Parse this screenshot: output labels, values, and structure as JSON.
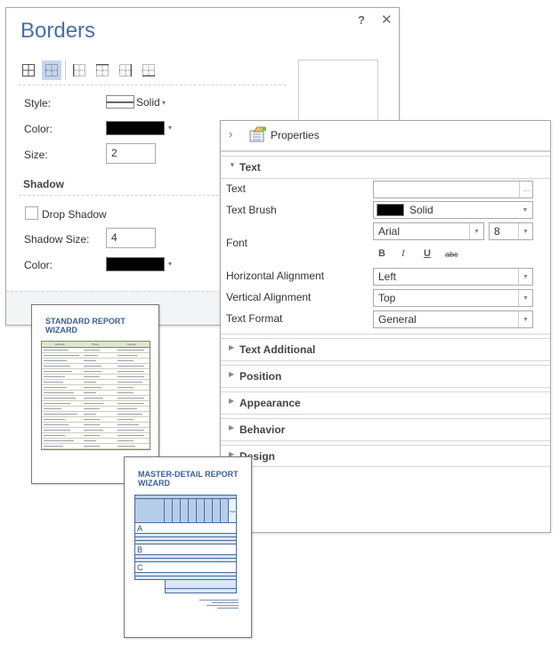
{
  "borders_dialog": {
    "title": "Borders",
    "help_label": "?",
    "close_label": "✕",
    "presets": [
      {
        "name": "all-borders",
        "selected": false
      },
      {
        "name": "no-borders",
        "selected": true
      },
      {
        "name": "left-border",
        "selected": false
      },
      {
        "name": "top-border",
        "selected": false
      },
      {
        "name": "right-border",
        "selected": false
      },
      {
        "name": "bottom-border",
        "selected": false
      }
    ],
    "style_label": "Style:",
    "style_value": "Solid",
    "color_label": "Color:",
    "color_value": "#000000",
    "size_label": "Size:",
    "size_value": "2",
    "shadow_title": "Shadow",
    "drop_shadow_label": "Drop Shadow",
    "drop_shadow_checked": false,
    "shadow_size_label": "Shadow Size:",
    "shadow_size_value": "4",
    "shadow_color_label": "Color:",
    "shadow_color_value": "#000000",
    "dropdown_glyph": "▾"
  },
  "reports": {
    "standard": {
      "title_line1": "STANDARD REPORT",
      "title_line2": "WIZARD",
      "columns": [
        "Address",
        "Phone",
        "Contact"
      ]
    },
    "master_detail": {
      "title_line1": "MASTER-DETAIL REPORT",
      "title_line2": "WIZARD",
      "groups": [
        "A",
        "B",
        "C"
      ],
      "total_label": "Total"
    }
  },
  "properties_panel": {
    "expander_glyph": "›",
    "title": "Properties",
    "text_category": "Text",
    "fields": {
      "text_label": "Text",
      "text_value": "",
      "ellipsis": "...",
      "text_brush_label": "Text Brush",
      "text_brush_value": "Solid",
      "text_brush_color": "#000000",
      "font_label": "Font",
      "font_name": "Arial",
      "font_size": "8",
      "bold": "B",
      "italic": "I",
      "underline": "U",
      "strikeout": "abc",
      "h_align_label": "Horizontal Alignment",
      "h_align_value": "Left",
      "v_align_label": "Vertical Alignment",
      "v_align_value": "Top",
      "text_format_label": "Text Format",
      "text_format_value": "General"
    },
    "collapsed_categories": [
      "Text Additional",
      "Position",
      "Appearance",
      "Behavior",
      "Design"
    ],
    "expanded_arrow": "▼",
    "collapsed_arrow": "▶"
  }
}
